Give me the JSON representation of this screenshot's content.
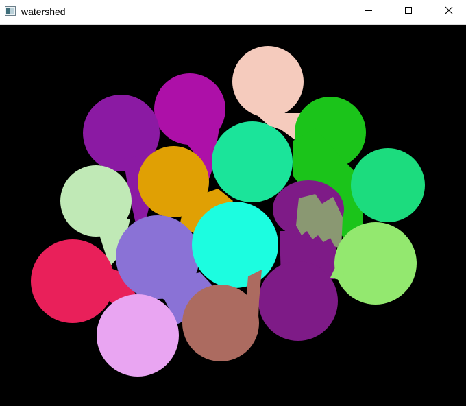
{
  "window": {
    "title": "watershed",
    "icon": "image-window-icon",
    "controls": {
      "minimize": "minimize-icon",
      "maximize": "maximize-icon",
      "close": "close-icon"
    }
  },
  "canvas": {
    "background": "#000000",
    "region_colors": [
      "#f5cbbd",
      "#ad10a8",
      "#8b1aa3",
      "#1bc41a",
      "#1be49a",
      "#1cdc7e",
      "#c0e9b6",
      "#e0a004",
      "#1cfde0",
      "#7e1b87",
      "#8a9872",
      "#93e86f",
      "#e9205a",
      "#8a72d6",
      "#ac6b60",
      "#e9a5f2"
    ]
  }
}
